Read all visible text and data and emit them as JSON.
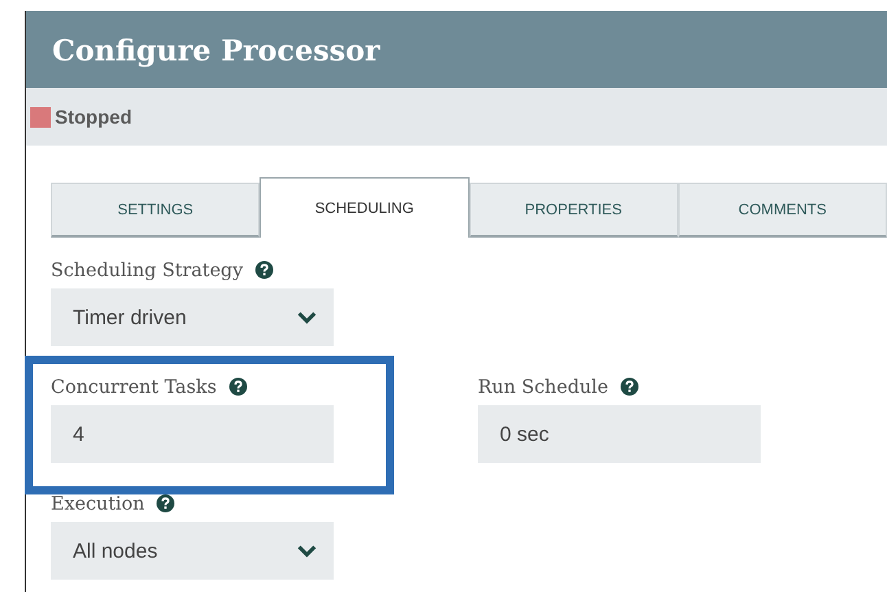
{
  "window": {
    "title": "Configure Processor"
  },
  "status": {
    "kind": "stopped",
    "label": "Stopped"
  },
  "tabs": [
    {
      "label": "SETTINGS",
      "selected": false
    },
    {
      "label": "SCHEDULING",
      "selected": true
    },
    {
      "label": "PROPERTIES",
      "selected": false
    },
    {
      "label": "COMMENTS",
      "selected": false
    }
  ],
  "rows": [
    [
      {
        "kind": "select",
        "label": "Scheduling Strategy",
        "value": "Timer driven",
        "highlighted": false
      }
    ],
    [
      {
        "kind": "text",
        "label": "Concurrent Tasks",
        "value": "4",
        "highlighted": true
      },
      {
        "kind": "text",
        "label": "Run Schedule",
        "value": "0 sec",
        "highlighted": false
      }
    ],
    [
      {
        "kind": "select",
        "label": "Execution",
        "value": "All nodes",
        "highlighted": false
      }
    ]
  ]
}
